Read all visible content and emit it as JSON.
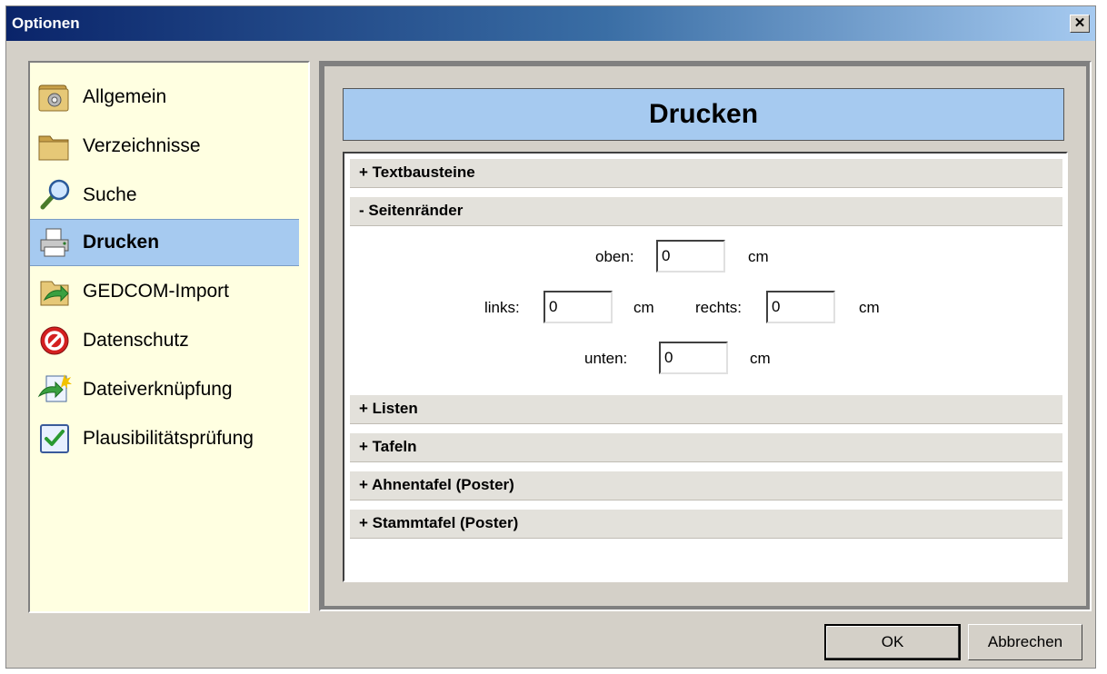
{
  "window": {
    "title": "Optionen",
    "close_glyph": "✕"
  },
  "sidebar": {
    "items": [
      {
        "label": "Allgemein",
        "icon": "gear-folder-icon",
        "selected": false
      },
      {
        "label": "Verzeichnisse",
        "icon": "folder-icon",
        "selected": false
      },
      {
        "label": "Suche",
        "icon": "magnifier-icon",
        "selected": false
      },
      {
        "label": "Drucken",
        "icon": "printer-icon",
        "selected": true
      },
      {
        "label": "GEDCOM-Import",
        "icon": "import-arrow-icon",
        "selected": false
      },
      {
        "label": "Datenschutz",
        "icon": "no-entry-icon",
        "selected": false
      },
      {
        "label": "Dateiverknüpfung",
        "icon": "file-link-icon",
        "selected": false
      },
      {
        "label": "Plausibilitätsprüfung",
        "icon": "checklist-icon",
        "selected": false
      }
    ]
  },
  "content": {
    "title": "Drucken",
    "sections": [
      {
        "label": "+ Textbausteine",
        "expanded": false
      },
      {
        "label": "- Seitenränder",
        "expanded": true
      },
      {
        "label": "+ Listen",
        "expanded": false
      },
      {
        "label": "+ Tafeln",
        "expanded": false
      },
      {
        "label": "+ Ahnentafel (Poster)",
        "expanded": false
      },
      {
        "label": "+ Stammtafel (Poster)",
        "expanded": false
      }
    ],
    "margins": {
      "top_label": "oben:",
      "top_value": "0",
      "left_label": "links:",
      "left_value": "0",
      "right_label": "rechts:",
      "right_value": "0",
      "bottom_label": "unten:",
      "bottom_value": "0",
      "unit": "cm"
    }
  },
  "buttons": {
    "ok": "OK",
    "cancel": "Abbrechen"
  },
  "colors": {
    "selection": "#a6caf0",
    "sidebar_bg": "#ffffe1",
    "dialog_bg": "#d4d0c8",
    "title_start": "#0a246a",
    "title_end": "#a6caf0"
  }
}
